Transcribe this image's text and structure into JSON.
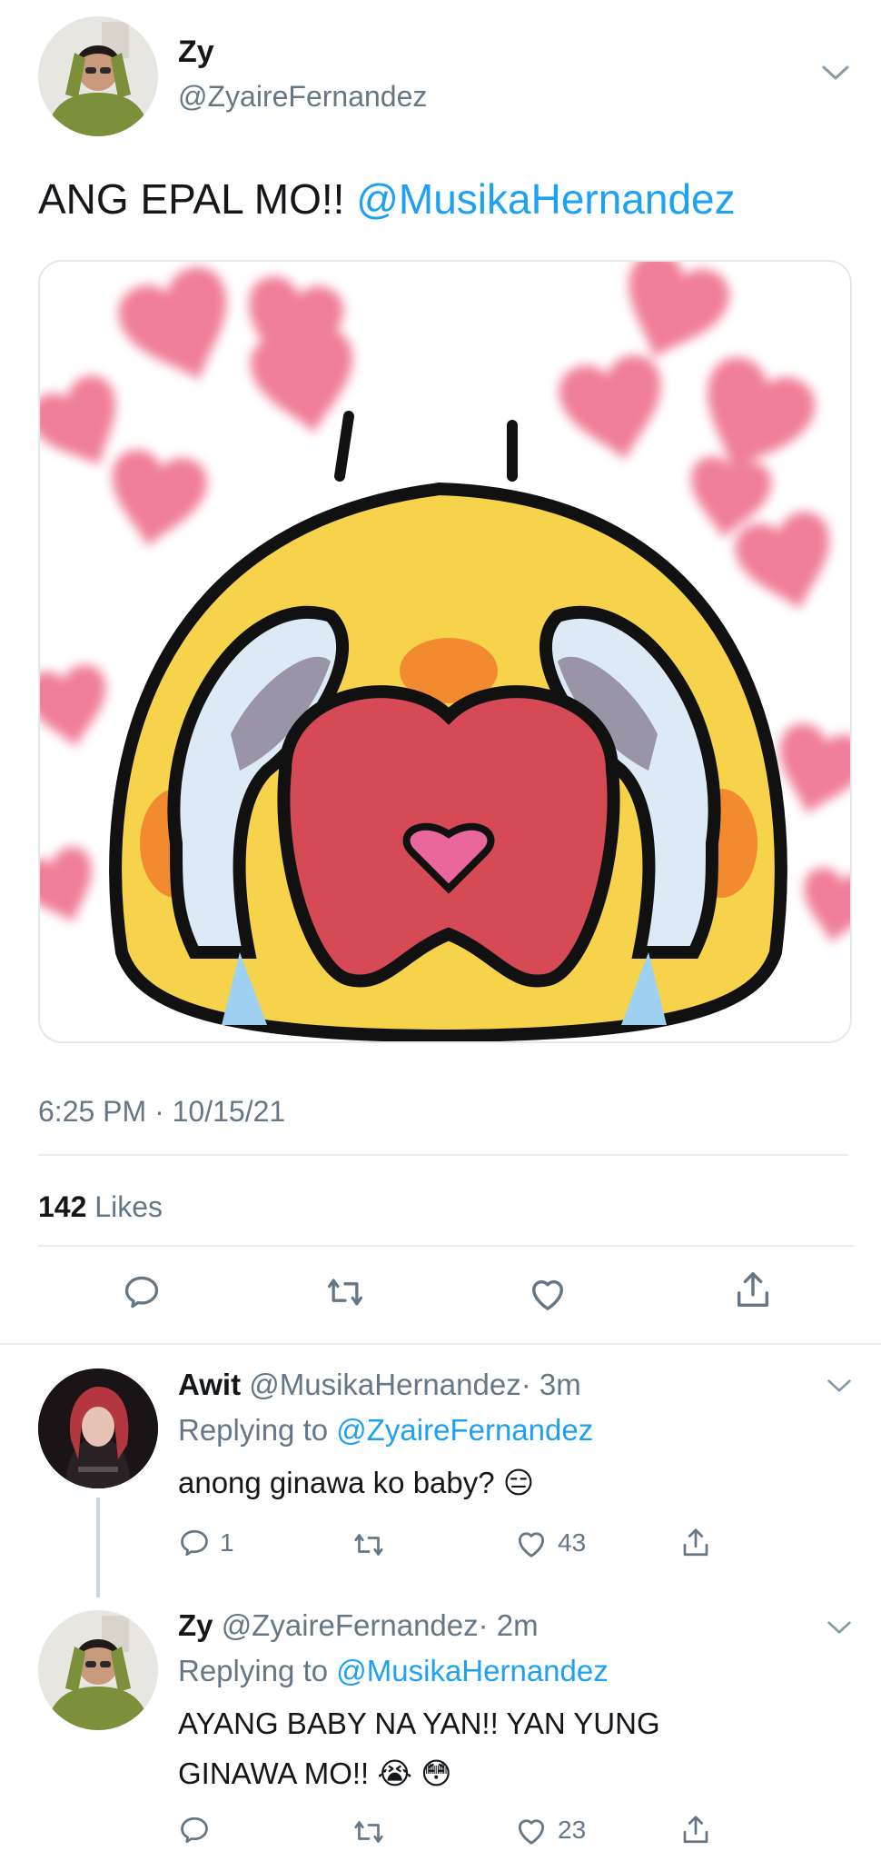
{
  "tweet": {
    "author_name": "Zy",
    "author_handle": "@ZyaireFernandez",
    "text": "ANG EPAL MO!! ",
    "mention": "@MusikaHernandez",
    "timestamp": "6:25 PM · 10/15/21",
    "likes_count": "142",
    "likes_label": "Likes"
  },
  "replies": [
    {
      "name": "Awit",
      "handle": "@MusikaHernandez",
      "time": "· 3m",
      "replying_label": "Replying to ",
      "replying_to": "@ZyaireFernandez",
      "text": "anong ginawa ko baby?",
      "emoji": "😑",
      "reply_count": "1",
      "like_count": "43"
    },
    {
      "name": "Zy",
      "handle": "@ZyaireFernandez",
      "time": "· 2m",
      "replying_label": "Replying to ",
      "replying_to": "@MusikaHernandez",
      "text_line1": "AYANG BABY NA YAN!! YAN YUNG",
      "text_line2": "GINAWA MO!!",
      "emoji": "😭 😳",
      "reply_count": "",
      "like_count": "23"
    }
  ],
  "colors": {
    "link": "#1da1f2",
    "muted": "#657786",
    "divider": "#e6ecf0"
  },
  "icons": [
    "chevron-down-icon",
    "reply-icon",
    "retweet-icon",
    "like-icon",
    "share-icon"
  ]
}
